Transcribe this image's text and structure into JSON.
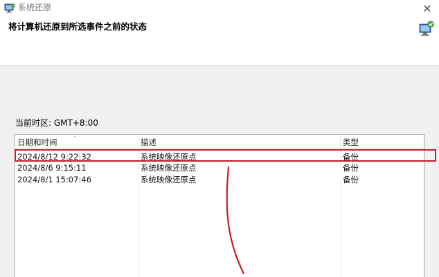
{
  "window": {
    "title": "系统还原",
    "close_glyph": "✕",
    "header_title": "将计算机还原到所选事件之前的状态"
  },
  "timezone_label": "当前时区: GMT+8:00",
  "table": {
    "columns": [
      "日期和时间",
      "描述",
      "类型"
    ],
    "sort_indicator": "ˇ",
    "rows": [
      {
        "date": "2024/8/12 9:22:32",
        "desc": "系统映像还原点",
        "type": "备份"
      },
      {
        "date": "2024/8/6 9:15:11",
        "desc": "系统映像还原点",
        "type": "备份"
      },
      {
        "date": "2024/8/1 15:07:46",
        "desc": "系统映像还原点",
        "type": "备份"
      }
    ]
  },
  "colors": {
    "annotation_red": "#c91b2a",
    "header_bg": "#ffffff",
    "body_bg": "#f0f0f0"
  },
  "icons": {
    "app": "system-restore-icon",
    "header": "computer-restore-icon"
  }
}
